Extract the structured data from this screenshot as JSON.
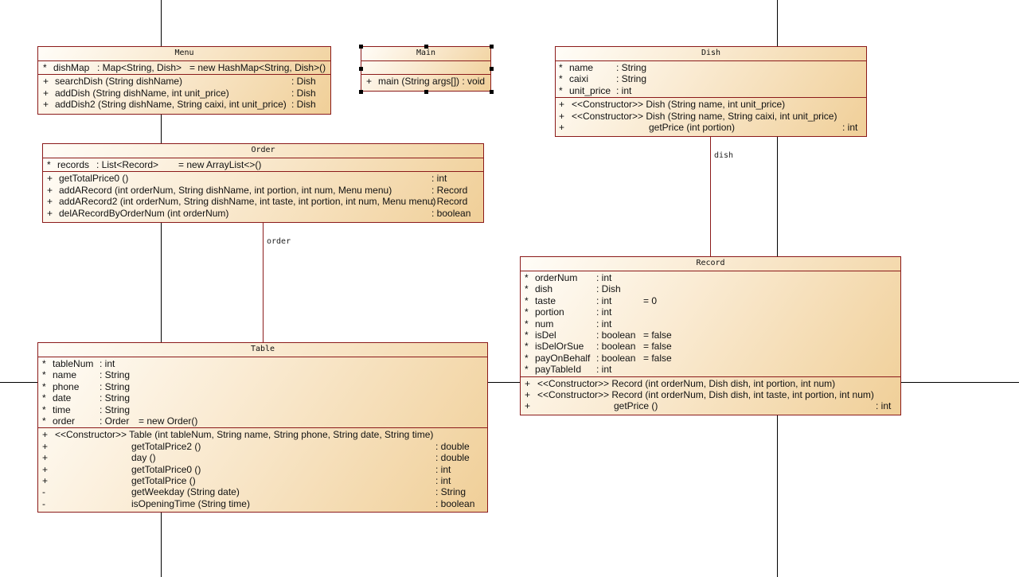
{
  "classes": {
    "menu": {
      "name": "Menu",
      "attributes": [
        {
          "vis": "*",
          "name": "dishMap",
          "type": ": Map<String, Dish>",
          "init": "= new HashMap<String, Dish>()"
        }
      ],
      "operations": [
        {
          "vis": "+",
          "sig": "searchDish (String dishName)",
          "ret": ": Dish"
        },
        {
          "vis": "+",
          "sig": "addDish (String dishName, int unit_price)",
          "ret": ": Dish"
        },
        {
          "vis": "+",
          "sig": "addDish2 (String dishName, String caixi, int unit_price)",
          "ret": ": Dish"
        }
      ]
    },
    "main": {
      "name": "Main",
      "operations": [
        {
          "vis": "+",
          "sig": "main (String args[]) : void"
        }
      ]
    },
    "dish": {
      "name": "Dish",
      "attributes": [
        {
          "vis": "*",
          "name": "name",
          "type": ": String"
        },
        {
          "vis": "*",
          "name": "caixi",
          "type": ": String"
        },
        {
          "vis": "*",
          "name": "unit_price",
          "type": ": int"
        }
      ],
      "operations": [
        {
          "vis": "+",
          "sig": "<<Constructor>> Dish (String name, int unit_price)",
          "ret": ""
        },
        {
          "vis": "+",
          "sig": "<<Constructor>> Dish (String name, String caixi, int unit_price)",
          "ret": ""
        },
        {
          "vis": "+",
          "sig": "getPrice (int portion)",
          "ret": ": int"
        }
      ]
    },
    "order": {
      "name": "Order",
      "attributes": [
        {
          "vis": "*",
          "name": "records",
          "type": ": List<Record>",
          "init": "= new ArrayList<>()"
        }
      ],
      "operations": [
        {
          "vis": "+",
          "sig": "getTotalPrice0 ()",
          "ret": ": int"
        },
        {
          "vis": "+",
          "sig": "addARecord (int orderNum, String dishName, int portion, int num, Menu menu)",
          "ret": ": Record"
        },
        {
          "vis": "+",
          "sig": "addARecord2 (int orderNum, String dishName, int taste, int portion, int num, Menu menu)",
          "ret": ": Record"
        },
        {
          "vis": "+",
          "sig": "delARecordByOrderNum (int orderNum)",
          "ret": ": boolean"
        }
      ]
    },
    "record": {
      "name": "Record",
      "attributes": [
        {
          "vis": "*",
          "name": "orderNum",
          "type": ": int",
          "init": ""
        },
        {
          "vis": "*",
          "name": "dish",
          "type": ": Dish",
          "init": ""
        },
        {
          "vis": "*",
          "name": "taste",
          "type": ": int",
          "init": "= 0"
        },
        {
          "vis": "*",
          "name": "portion",
          "type": ": int",
          "init": ""
        },
        {
          "vis": "*",
          "name": "num",
          "type": ": int",
          "init": ""
        },
        {
          "vis": "*",
          "name": "isDel",
          "type": ": boolean",
          "init": "= false"
        },
        {
          "vis": "*",
          "name": "isDelOrSue",
          "type": ": boolean",
          "init": "= false"
        },
        {
          "vis": "*",
          "name": "payOnBehalf",
          "type": ": boolean",
          "init": "= false"
        },
        {
          "vis": "*",
          "name": "payTableId",
          "type": ": int",
          "init": ""
        }
      ],
      "operations": [
        {
          "vis": "+",
          "sig": "<<Constructor>> Record (int orderNum, Dish dish, int portion, int num)",
          "ret": ""
        },
        {
          "vis": "+",
          "sig": "<<Constructor>> Record (int orderNum, Dish dish, int taste, int portion, int num)",
          "ret": ""
        },
        {
          "vis": "+",
          "sig": "getPrice ()",
          "ret": ": int"
        }
      ]
    },
    "table": {
      "name": "Table",
      "attributes": [
        {
          "vis": "*",
          "name": "tableNum",
          "type": ": int",
          "init": ""
        },
        {
          "vis": "*",
          "name": "name",
          "type": ": String",
          "init": ""
        },
        {
          "vis": "*",
          "name": "phone",
          "type": ": String",
          "init": ""
        },
        {
          "vis": "*",
          "name": "date",
          "type": ": String",
          "init": ""
        },
        {
          "vis": "*",
          "name": "time",
          "type": ": String",
          "init": ""
        },
        {
          "vis": "*",
          "name": "order",
          "type": ": Order",
          "init": "= new Order()"
        }
      ],
      "operations": [
        {
          "vis": "+",
          "sig": "<<Constructor>> Table (int tableNum, String name, String phone, String date, String time)",
          "ret": ""
        },
        {
          "vis": "+",
          "sig": "getTotalPrice2 ()",
          "ret": ": double"
        },
        {
          "vis": "+",
          "sig": "day ()",
          "ret": ": double"
        },
        {
          "vis": "+",
          "sig": "getTotalPrice0 ()",
          "ret": ": int"
        },
        {
          "vis": "+",
          "sig": "getTotalPrice ()",
          "ret": ": int"
        },
        {
          "vis": "-",
          "sig": "getWeekday (String date)",
          "ret": ": String"
        },
        {
          "vis": "-",
          "sig": "isOpeningTime (String time)",
          "ret": ": boolean"
        }
      ]
    }
  },
  "associations": {
    "dish_label": "dish",
    "order_label": "order"
  },
  "colors": {
    "border": "#8b1a1a",
    "fill_light": "#fffdf8",
    "fill_dark": "#f0cf98"
  }
}
